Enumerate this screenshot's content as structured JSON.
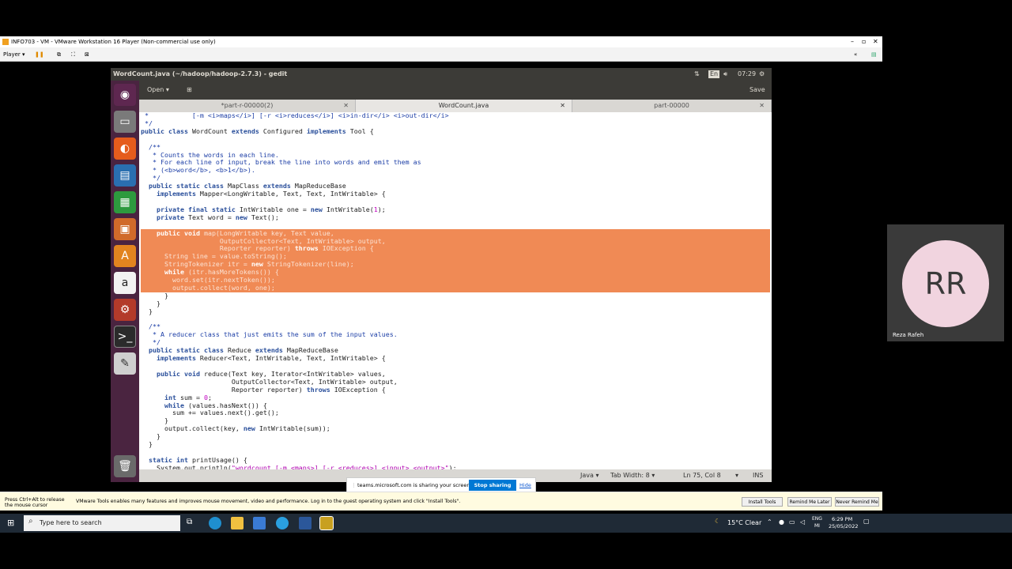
{
  "vm": {
    "title": "INFO703 - VM - VMware Workstation 16 Player (Non-commercial use only)",
    "player_label": "Player ▾"
  },
  "gedit": {
    "title": "WordCount.java (~/hadoop/hadoop-2.7.3) - gedit",
    "open_label": "Open ▾",
    "save_label": "Save",
    "tabs": [
      {
        "label": "*part-r-00000(2)"
      },
      {
        "label": "WordCount.java"
      },
      {
        "label": "part-00000"
      }
    ],
    "status": {
      "language": "Java ▾",
      "tab_width": "Tab Width: 8 ▾",
      "position": "Ln 75, Col 8",
      "mode": "INS"
    }
  },
  "ubuntu_topbar": {
    "lang": "En",
    "time": "07:29"
  },
  "teams": {
    "sharing_text": "teams.microsoft.com is sharing your screen.",
    "stop_label": "Stop sharing",
    "hide_label": "Hide"
  },
  "vmware_tools": {
    "release_hint": "Press Ctrl+Alt to release the mouse cursor",
    "message": "VMware Tools enables many features and improves mouse movement, video and performance. Log in to the guest operating system and click \"Install Tools\".",
    "install_label": "Install Tools",
    "remind_label": "Remind Me Later",
    "never_label": "Never Remind Me"
  },
  "participant": {
    "initials": "RR",
    "name": "Reza Rafeh"
  },
  "taskbar": {
    "search_placeholder": "Type here to search",
    "weather": "15°C  Clear",
    "lang_top": "ENG",
    "lang_bottom": "MI",
    "time": "6:29 PM",
    "date": "25/05/2022"
  },
  "code_lines": [
    " *           [-m <i>maps</i>] [-r <i>reduces</i>] <i>in-dir</i> <i>out-dir</i>",
    " */",
    "public class WordCount extends Configured implements Tool {",
    "",
    "  /**",
    "   * Counts the words in each line.",
    "   * For each line of input, break the line into words and emit them as",
    "   * (<b>word</b>, <b>1</b>).",
    "   */",
    "  public static class MapClass extends MapReduceBase",
    "    implements Mapper<LongWritable, Text, Text, IntWritable> {",
    "",
    "    private final static IntWritable one = new IntWritable(1);",
    "    private Text word = new Text();",
    "",
    "    public void map(LongWritable key, Text value,",
    "                    OutputCollector<Text, IntWritable> output,",
    "                    Reporter reporter) throws IOException {",
    "      String line = value.toString();",
    "      StringTokenizer itr = new StringTokenizer(line);",
    "      while (itr.hasMoreTokens()) {",
    "        word.set(itr.nextToken());",
    "        output.collect(word, one);",
    "      }",
    "    }",
    "  }",
    "",
    "  /**",
    "   * A reducer class that just emits the sum of the input values.",
    "   */",
    "  public static class Reduce extends MapReduceBase",
    "    implements Reducer<Text, IntWritable, Text, IntWritable> {",
    "",
    "    public void reduce(Text key, Iterator<IntWritable> values,",
    "                       OutputCollector<Text, IntWritable> output,",
    "                       Reporter reporter) throws IOException {",
    "      int sum = 0;",
    "      while (values.hasNext()) {",
    "        sum += values.next().get();",
    "      }",
    "      output.collect(key, new IntWritable(sum));",
    "    }",
    "  }",
    "",
    "  static int printUsage() {",
    "    System.out.println(\"wordcount [-m <maps>] [-r <reduces>] <input> <output>\");"
  ],
  "selected_lines": [
    15,
    16,
    17,
    18,
    19,
    20,
    21,
    22
  ]
}
